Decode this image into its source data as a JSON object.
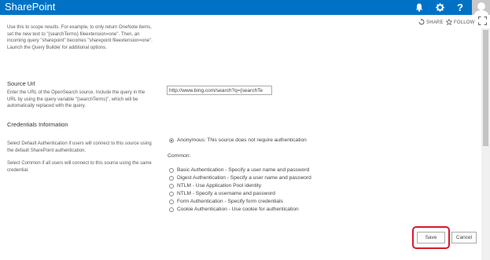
{
  "suite_bar": {
    "brand": "SharePoint",
    "icons": [
      "bell-icon",
      "gear-icon",
      "help-icon"
    ],
    "help_label": "?",
    "color": "#0072c6"
  },
  "actions": {
    "share": "SHARE",
    "follow": "FOLLOW"
  },
  "intro_text": "Use this to scope results. For example, to only return OneNote items, set the new text to \"{searchTerms} fileextension=one\". Then, an incoming query \"sharepoint\" becomes \"sharepoint fileextension=one\". Launch the Query Builder for additional options.",
  "source_url": {
    "title": "Source Url",
    "description": "Enter the URL of the OpenSearch source. Include the query in the URL by using the query variable \"{searchTerms}\", which will be automatically replaced with the query.",
    "value": "http://www.bing.com/search?q={searchTe"
  },
  "credentials": {
    "title": "Credentials Information",
    "description_default": "Select Default Authentication if users will connect to this source using the default SharePoint authentication.",
    "description_common": "Select Common if all users will connect to this source using the same credential.",
    "anonymous_option": "Anonymous: This source does not require authentication",
    "anonymous_selected": true,
    "common_label": "Common:",
    "options": [
      "Basic Authentication - Specify a user name and password",
      "Digest Authentication - Specify a user name and password",
      "NTLM - Use Application Pool identity",
      "NTLM - Specify a username and password",
      "Form Authentication - Specify form credentials",
      "Cookie Authentication - Use cookie for authentication"
    ]
  },
  "buttons": {
    "save": "Save",
    "cancel": "Cancel",
    "highlight_color": "#d7192c"
  }
}
